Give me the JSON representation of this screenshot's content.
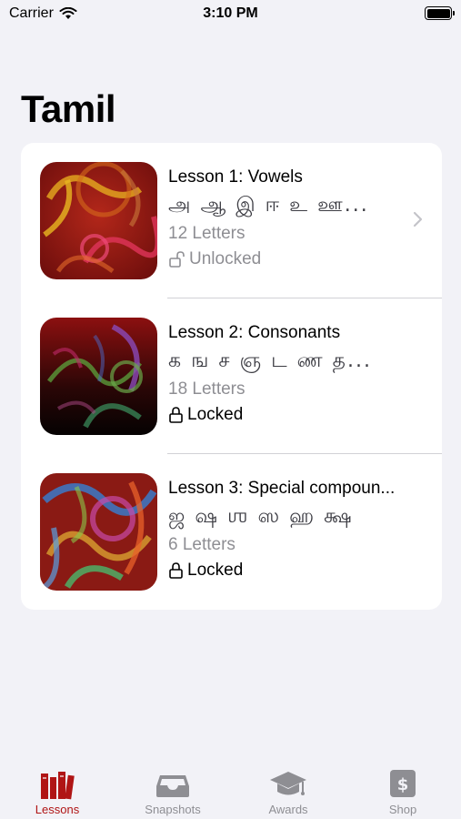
{
  "status_bar": {
    "carrier": "Carrier",
    "time": "3:10 PM"
  },
  "page": {
    "title": "Tamil"
  },
  "lessons": [
    {
      "title": "Lesson 1: Vowels",
      "letters": "அ ஆ இ ஈ உ ஊ...",
      "count": "12 Letters",
      "status": "Unlocked",
      "status_icon": "lock-open-icon"
    },
    {
      "title": "Lesson 2: Consonants",
      "letters": "க ங ச ஞ ட ண த...",
      "count": "18 Letters",
      "status": "Locked",
      "status_icon": "lock-icon"
    },
    {
      "title": "Lesson 3: Special compoun...",
      "letters": "ஜ ஷ ஶ ஸ ஹ க்ஷ",
      "count": "6 Letters",
      "status": "Locked",
      "status_icon": "lock-icon"
    }
  ],
  "tab_bar": {
    "tabs": [
      {
        "label": "Lessons",
        "icon": "books-icon",
        "active": true
      },
      {
        "label": "Snapshots",
        "icon": "tray-icon",
        "active": false
      },
      {
        "label": "Awards",
        "icon": "graduation-cap-icon",
        "active": false
      },
      {
        "label": "Shop",
        "icon": "dollar-icon",
        "active": false
      }
    ]
  },
  "colors": {
    "accent": "#b01515",
    "background": "#f2f2f7",
    "secondary_text": "#8e8e93"
  }
}
